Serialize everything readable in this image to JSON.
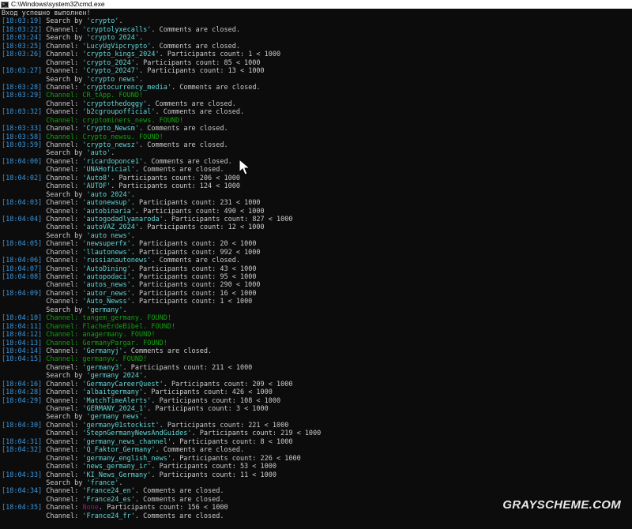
{
  "window": {
    "title": "C:\\Windows\\system32\\cmd.exe",
    "icon": "cmd-icon"
  },
  "watermark": "GRAYSCHEME.COM",
  "colors": {
    "timestamp": "#3a96dd",
    "quoted": "#61d6d6",
    "found": "#13a10e",
    "none": "#b4009e",
    "default": "#cccccc"
  },
  "lines": [
    {
      "ts": "",
      "segs": [
        {
          "t": "Вход успешно выполнен!",
          "c": "white"
        }
      ]
    },
    {
      "ts": "[18:03:19]",
      "segs": [
        {
          "t": " Search by ",
          "c": "white"
        },
        {
          "t": "'crypto'",
          "c": "cyan"
        },
        {
          "t": ".",
          "c": "white"
        }
      ]
    },
    {
      "ts": "[18:03:22]",
      "segs": [
        {
          "t": " Channel: ",
          "c": "white"
        },
        {
          "t": "'cryptolyxecalls'",
          "c": "cyan"
        },
        {
          "t": ". Comments are closed.",
          "c": "white"
        }
      ]
    },
    {
      "ts": "[18:03:24]",
      "segs": [
        {
          "t": " Search by ",
          "c": "white"
        },
        {
          "t": "'crypto 2024'",
          "c": "cyan"
        },
        {
          "t": ".",
          "c": "white"
        }
      ]
    },
    {
      "ts": "[18:03:25]",
      "segs": [
        {
          "t": " Channel: ",
          "c": "white"
        },
        {
          "t": "'LucyUgVipcrypto'",
          "c": "cyan"
        },
        {
          "t": ". Comments are closed.",
          "c": "white"
        }
      ]
    },
    {
      "ts": "[18:03:26]",
      "segs": [
        {
          "t": " Channel: ",
          "c": "white"
        },
        {
          "t": "'crypto_kings_2024'",
          "c": "cyan"
        },
        {
          "t": ". Participants count: 1 < 1000",
          "c": "white"
        }
      ]
    },
    {
      "ts": "",
      "segs": [
        {
          "t": "           Channel: ",
          "c": "white"
        },
        {
          "t": "'crypto_2024'",
          "c": "cyan"
        },
        {
          "t": ". Participants count: 85 < 1000",
          "c": "white"
        }
      ]
    },
    {
      "ts": "[18:03:27]",
      "segs": [
        {
          "t": " Channel: ",
          "c": "white"
        },
        {
          "t": "'Crypto_20247'",
          "c": "cyan"
        },
        {
          "t": ". Participants count: 13 < 1000",
          "c": "white"
        }
      ]
    },
    {
      "ts": "",
      "segs": [
        {
          "t": "           Search by ",
          "c": "white"
        },
        {
          "t": "'crypto news'",
          "c": "cyan"
        },
        {
          "t": ".",
          "c": "white"
        }
      ]
    },
    {
      "ts": "[18:03:28]",
      "segs": [
        {
          "t": " Channel: ",
          "c": "white"
        },
        {
          "t": "'cryptocurrency_media'",
          "c": "cyan"
        },
        {
          "t": ". Comments are closed.",
          "c": "white"
        }
      ]
    },
    {
      "ts": "[18:03:29]",
      "segs": [
        {
          "t": " Channel: CR_tApp. FOUND!",
          "c": "green"
        }
      ]
    },
    {
      "ts": "",
      "segs": [
        {
          "t": "           Channel: ",
          "c": "white"
        },
        {
          "t": "'cryptothedoggy'",
          "c": "cyan"
        },
        {
          "t": ". Comments are closed.",
          "c": "white"
        }
      ]
    },
    {
      "ts": "[18:03:32]",
      "segs": [
        {
          "t": " Channel: ",
          "c": "white"
        },
        {
          "t": "'b2cgroupofficial'",
          "c": "cyan"
        },
        {
          "t": ". Comments are closed.",
          "c": "white"
        }
      ]
    },
    {
      "ts": "",
      "segs": [
        {
          "t": "           Channel: cryptominers_news. FOUND!",
          "c": "green"
        }
      ]
    },
    {
      "ts": "[18:03:33]",
      "segs": [
        {
          "t": " Channel: ",
          "c": "white"
        },
        {
          "t": "'Crypto_Newsm'",
          "c": "cyan"
        },
        {
          "t": ". Comments are closed.",
          "c": "white"
        }
      ]
    },
    {
      "ts": "[18:03:58]",
      "segs": [
        {
          "t": " Channel: Crypto_newsu. FOUND!",
          "c": "green"
        }
      ]
    },
    {
      "ts": "[18:03:59]",
      "segs": [
        {
          "t": " Channel: ",
          "c": "white"
        },
        {
          "t": "'crypto_newsz'",
          "c": "cyan"
        },
        {
          "t": ". Comments are closed.",
          "c": "white"
        }
      ]
    },
    {
      "ts": "",
      "segs": [
        {
          "t": "           Search by ",
          "c": "white"
        },
        {
          "t": "'auto'",
          "c": "cyan"
        },
        {
          "t": ".",
          "c": "white"
        }
      ]
    },
    {
      "ts": "[18:04:00]",
      "segs": [
        {
          "t": " Channel: ",
          "c": "white"
        },
        {
          "t": "'ricardoponce1'",
          "c": "cyan"
        },
        {
          "t": ". Comments are closed.",
          "c": "white"
        }
      ]
    },
    {
      "ts": "",
      "segs": [
        {
          "t": "           Channel: ",
          "c": "white"
        },
        {
          "t": "'UNAHoficial'",
          "c": "cyan"
        },
        {
          "t": ". Comments are closed.",
          "c": "white"
        }
      ]
    },
    {
      "ts": "[18:04:02]",
      "segs": [
        {
          "t": " Channel: ",
          "c": "white"
        },
        {
          "t": "'Auto8'",
          "c": "cyan"
        },
        {
          "t": ". Participants count: 206 < 1000",
          "c": "white"
        }
      ]
    },
    {
      "ts": "",
      "segs": [
        {
          "t": "           Channel: ",
          "c": "white"
        },
        {
          "t": "'AUTOF'",
          "c": "cyan"
        },
        {
          "t": ". Participants count: 124 < 1000",
          "c": "white"
        }
      ]
    },
    {
      "ts": "",
      "segs": [
        {
          "t": "           Search by ",
          "c": "white"
        },
        {
          "t": "'auto 2024'",
          "c": "cyan"
        },
        {
          "t": ".",
          "c": "white"
        }
      ]
    },
    {
      "ts": "[18:04:03]",
      "segs": [
        {
          "t": " Channel: ",
          "c": "white"
        },
        {
          "t": "'autonewsup'",
          "c": "cyan"
        },
        {
          "t": ". Participants count: 231 < 1000",
          "c": "white"
        }
      ]
    },
    {
      "ts": "",
      "segs": [
        {
          "t": "           Channel: ",
          "c": "white"
        },
        {
          "t": "'autobinaria'",
          "c": "cyan"
        },
        {
          "t": ". Participants count: 490 < 1000",
          "c": "white"
        }
      ]
    },
    {
      "ts": "[18:04:04]",
      "segs": [
        {
          "t": " Channel: ",
          "c": "white"
        },
        {
          "t": "'autogodadlyanaroda'",
          "c": "cyan"
        },
        {
          "t": ". Participants count: 827 < 1000",
          "c": "white"
        }
      ]
    },
    {
      "ts": "",
      "segs": [
        {
          "t": "           Channel: ",
          "c": "white"
        },
        {
          "t": "'autoVAZ_2024'",
          "c": "cyan"
        },
        {
          "t": ". Participants count: 12 < 1000",
          "c": "white"
        }
      ]
    },
    {
      "ts": "",
      "segs": [
        {
          "t": "           Search by ",
          "c": "white"
        },
        {
          "t": "'auto news'",
          "c": "cyan"
        },
        {
          "t": ".",
          "c": "white"
        }
      ]
    },
    {
      "ts": "[18:04:05]",
      "segs": [
        {
          "t": " Channel: ",
          "c": "white"
        },
        {
          "t": "'newsuperfx'",
          "c": "cyan"
        },
        {
          "t": ". Participants count: 20 < 1000",
          "c": "white"
        }
      ]
    },
    {
      "ts": "",
      "segs": [
        {
          "t": "           Channel: ",
          "c": "white"
        },
        {
          "t": "'llautonews'",
          "c": "cyan"
        },
        {
          "t": ". Participants count: 992 < 1000",
          "c": "white"
        }
      ]
    },
    {
      "ts": "[18:04:06]",
      "segs": [
        {
          "t": " Channel: ",
          "c": "white"
        },
        {
          "t": "'russianautonews'",
          "c": "cyan"
        },
        {
          "t": ". Comments are closed.",
          "c": "white"
        }
      ]
    },
    {
      "ts": "[18:04:07]",
      "segs": [
        {
          "t": " Channel: ",
          "c": "white"
        },
        {
          "t": "'AutoDining'",
          "c": "cyan"
        },
        {
          "t": ". Participants count: 43 < 1000",
          "c": "white"
        }
      ]
    },
    {
      "ts": "[18:04:08]",
      "segs": [
        {
          "t": " Channel: ",
          "c": "white"
        },
        {
          "t": "'autopodaci'",
          "c": "cyan"
        },
        {
          "t": ". Participants count: 95 < 1000",
          "c": "white"
        }
      ]
    },
    {
      "ts": "",
      "segs": [
        {
          "t": "           Channel: ",
          "c": "white"
        },
        {
          "t": "'autos_news'",
          "c": "cyan"
        },
        {
          "t": ". Participants count: 290 < 1000",
          "c": "white"
        }
      ]
    },
    {
      "ts": "[18:04:09]",
      "segs": [
        {
          "t": " Channel: ",
          "c": "white"
        },
        {
          "t": "'autor_news'",
          "c": "cyan"
        },
        {
          "t": ". Participants count: 16 < 1000",
          "c": "white"
        }
      ]
    },
    {
      "ts": "",
      "segs": [
        {
          "t": "           Channel: ",
          "c": "white"
        },
        {
          "t": "'Auto_Newss'",
          "c": "cyan"
        },
        {
          "t": ". Participants count: 1 < 1000",
          "c": "white"
        }
      ]
    },
    {
      "ts": "",
      "segs": [
        {
          "t": "           Search by ",
          "c": "white"
        },
        {
          "t": "'germany'",
          "c": "cyan"
        },
        {
          "t": ".",
          "c": "white"
        }
      ]
    },
    {
      "ts": "[18:04:10]",
      "segs": [
        {
          "t": " Channel: tangem_germany. FOUND!",
          "c": "green"
        }
      ]
    },
    {
      "ts": "[18:04:11]",
      "segs": [
        {
          "t": " Channel: FlacheErdeBibel. FOUND!",
          "c": "green"
        }
      ]
    },
    {
      "ts": "[18:04:12]",
      "segs": [
        {
          "t": " Channel: anagermany. FOUND!",
          "c": "green"
        }
      ]
    },
    {
      "ts": "[18:04:13]",
      "segs": [
        {
          "t": " Channel: GermanyPargar. FOUND!",
          "c": "green"
        }
      ]
    },
    {
      "ts": "[18:04:14]",
      "segs": [
        {
          "t": " Channel: ",
          "c": "white"
        },
        {
          "t": "'Germanyj'",
          "c": "cyan"
        },
        {
          "t": ". Comments are closed.",
          "c": "white"
        }
      ]
    },
    {
      "ts": "[18:04:15]",
      "segs": [
        {
          "t": " Channel: germanyv. FOUND!",
          "c": "green"
        }
      ]
    },
    {
      "ts": "",
      "segs": [
        {
          "t": "           Channel: ",
          "c": "white"
        },
        {
          "t": "'germany3'",
          "c": "cyan"
        },
        {
          "t": ". Participants count: 211 < 1000",
          "c": "white"
        }
      ]
    },
    {
      "ts": "",
      "segs": [
        {
          "t": "           Search by ",
          "c": "white"
        },
        {
          "t": "'germany 2024'",
          "c": "cyan"
        },
        {
          "t": ".",
          "c": "white"
        }
      ]
    },
    {
      "ts": "[18:04:16]",
      "segs": [
        {
          "t": " Channel: ",
          "c": "white"
        },
        {
          "t": "'GermanyCareerQuest'",
          "c": "cyan"
        },
        {
          "t": ". Participants count: 209 < 1000",
          "c": "white"
        }
      ]
    },
    {
      "ts": "[18:04:28]",
      "segs": [
        {
          "t": " Channel: ",
          "c": "white"
        },
        {
          "t": "'albaitgermany'",
          "c": "cyan"
        },
        {
          "t": ". Participants count: 426 < 1000",
          "c": "white"
        }
      ]
    },
    {
      "ts": "[18:04:29]",
      "segs": [
        {
          "t": " Channel: ",
          "c": "white"
        },
        {
          "t": "'MatchTimeAlerts'",
          "c": "cyan"
        },
        {
          "t": ". Participants count: 108 < 1000",
          "c": "white"
        }
      ]
    },
    {
      "ts": "",
      "segs": [
        {
          "t": "           Channel: ",
          "c": "white"
        },
        {
          "t": "'GERMANY_2024_1'",
          "c": "cyan"
        },
        {
          "t": ". Participants count: 3 < 1000",
          "c": "white"
        }
      ]
    },
    {
      "ts": "",
      "segs": [
        {
          "t": "           Search by ",
          "c": "white"
        },
        {
          "t": "'germany news'",
          "c": "cyan"
        },
        {
          "t": ".",
          "c": "white"
        }
      ]
    },
    {
      "ts": "[18:04:30]",
      "segs": [
        {
          "t": " Channel: ",
          "c": "white"
        },
        {
          "t": "'germany01stockist'",
          "c": "cyan"
        },
        {
          "t": ". Participants count: 221 < 1000",
          "c": "white"
        }
      ]
    },
    {
      "ts": "",
      "segs": [
        {
          "t": "           Channel: ",
          "c": "white"
        },
        {
          "t": "'StepnGermanyNewsAndGuides'",
          "c": "cyan"
        },
        {
          "t": ". Participants count: 219 < 1000",
          "c": "white"
        }
      ]
    },
    {
      "ts": "[18:04:31]",
      "segs": [
        {
          "t": " Channel: ",
          "c": "white"
        },
        {
          "t": "'germany_news_channel'",
          "c": "cyan"
        },
        {
          "t": ". Participants count: 8 < 1000",
          "c": "white"
        }
      ]
    },
    {
      "ts": "[18:04:32]",
      "segs": [
        {
          "t": " Channel: ",
          "c": "white"
        },
        {
          "t": "'Q_Faktor_Germany'",
          "c": "cyan"
        },
        {
          "t": ". Comments are closed.",
          "c": "white"
        }
      ]
    },
    {
      "ts": "",
      "segs": [
        {
          "t": "           Channel: ",
          "c": "white"
        },
        {
          "t": "'germany_english_news'",
          "c": "cyan"
        },
        {
          "t": ". Participants count: 226 < 1000",
          "c": "white"
        }
      ]
    },
    {
      "ts": "",
      "segs": [
        {
          "t": "           Channel: ",
          "c": "white"
        },
        {
          "t": "'news_germany_ir'",
          "c": "cyan"
        },
        {
          "t": ". Participants count: 53 < 1000",
          "c": "white"
        }
      ]
    },
    {
      "ts": "[18:04:33]",
      "segs": [
        {
          "t": " Channel: ",
          "c": "white"
        },
        {
          "t": "'KI_News_Germany'",
          "c": "cyan"
        },
        {
          "t": ". Participants count: 11 < 1000",
          "c": "white"
        }
      ]
    },
    {
      "ts": "",
      "segs": [
        {
          "t": "           Search by ",
          "c": "white"
        },
        {
          "t": "'france'",
          "c": "cyan"
        },
        {
          "t": ".",
          "c": "white"
        }
      ]
    },
    {
      "ts": "[18:04:34]",
      "segs": [
        {
          "t": " Channel: ",
          "c": "white"
        },
        {
          "t": "'France24_en'",
          "c": "cyan"
        },
        {
          "t": ". Comments are closed.",
          "c": "white"
        }
      ]
    },
    {
      "ts": "",
      "segs": [
        {
          "t": "           Channel: ",
          "c": "white"
        },
        {
          "t": "'France24_es'",
          "c": "cyan"
        },
        {
          "t": ". Comments are closed.",
          "c": "white"
        }
      ]
    },
    {
      "ts": "[18:04:35]",
      "segs": [
        {
          "t": " Channel: ",
          "c": "white"
        },
        {
          "t": "None",
          "c": "magenta"
        },
        {
          "t": ". Participants count: 156 < 1000",
          "c": "white"
        }
      ]
    },
    {
      "ts": "",
      "segs": [
        {
          "t": "           Channel: ",
          "c": "white"
        },
        {
          "t": "'France24_fr'",
          "c": "cyan"
        },
        {
          "t": ". Comments are closed.",
          "c": "white"
        }
      ]
    }
  ]
}
